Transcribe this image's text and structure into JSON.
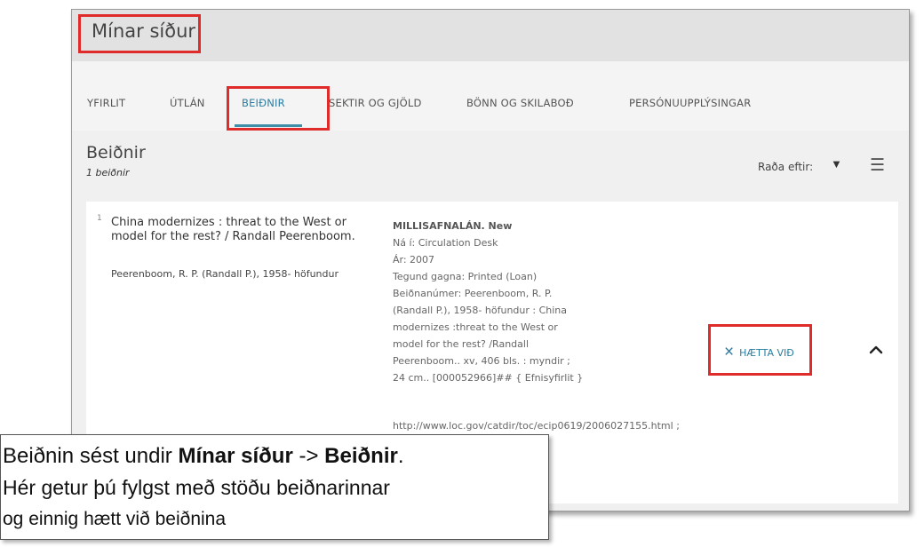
{
  "header": {
    "title": "Mínar síður"
  },
  "tabs": [
    {
      "label": "YFIRLIT",
      "active": false
    },
    {
      "label": "ÚTLÁN",
      "active": false
    },
    {
      "label": "BEIÐNIR",
      "active": true
    },
    {
      "label": "SEKTIR OG GJÖLD",
      "active": false
    },
    {
      "label": "BÖNN OG SKILABOÐ",
      "active": false
    },
    {
      "label": "PERSÓNUUPPLÝSINGAR",
      "active": false
    }
  ],
  "requests": {
    "heading": "Beiðnir",
    "count": "1 beiðnir",
    "sort_label": "Raða eftir:",
    "sort_caret": "▼",
    "sort_icon": "sort-icon"
  },
  "item": {
    "number": "1",
    "title": "China modernizes : threat to the West or model for the rest? / Randall Peerenboom.",
    "author": "Peerenboom, R. P. (Randall P.), 1958- höfundur",
    "details": {
      "status": "MILLISAFNALÁN. New",
      "location": "Ná í: Circulation Desk",
      "year": "Ár: 2007",
      "material_type": "Tegund gagna: Printed (Loan)",
      "request_line1": "Beiðnanúmer: Peerenboom, R. P.",
      "request_line2": "(Randall P.), 1958- höfundur : China",
      "request_line3": "modernizes :threat to the West or",
      "request_line4": "model for the rest? /Randall",
      "request_line5": "Peerenboom.. xv, 406 bls. : myndir ;",
      "request_line6": "24 cm.. [000052966]## { Efnisyfirlit }",
      "url": "http://www.loc.gov/catdir/toc/ecip0619/2006027155.html ;"
    },
    "cancel_label": "HÆTTA VIÐ",
    "cancel_icon": "×"
  },
  "callout": {
    "line1_pre": "Beiðnin sést undir ",
    "line1_b1": "Mínar síður",
    "line1_mid": " -> ",
    "line1_b2": "Beiðnir",
    "line1_post": ".",
    "line2": "Hér getur þú fylgst með stöðu beiðnarinnar",
    "line3": "og einnig hætt við beiðnina"
  },
  "colors": {
    "highlight": "#e02b2b",
    "accent": "#2a7da1",
    "header_bg": "#e2e2e2"
  }
}
